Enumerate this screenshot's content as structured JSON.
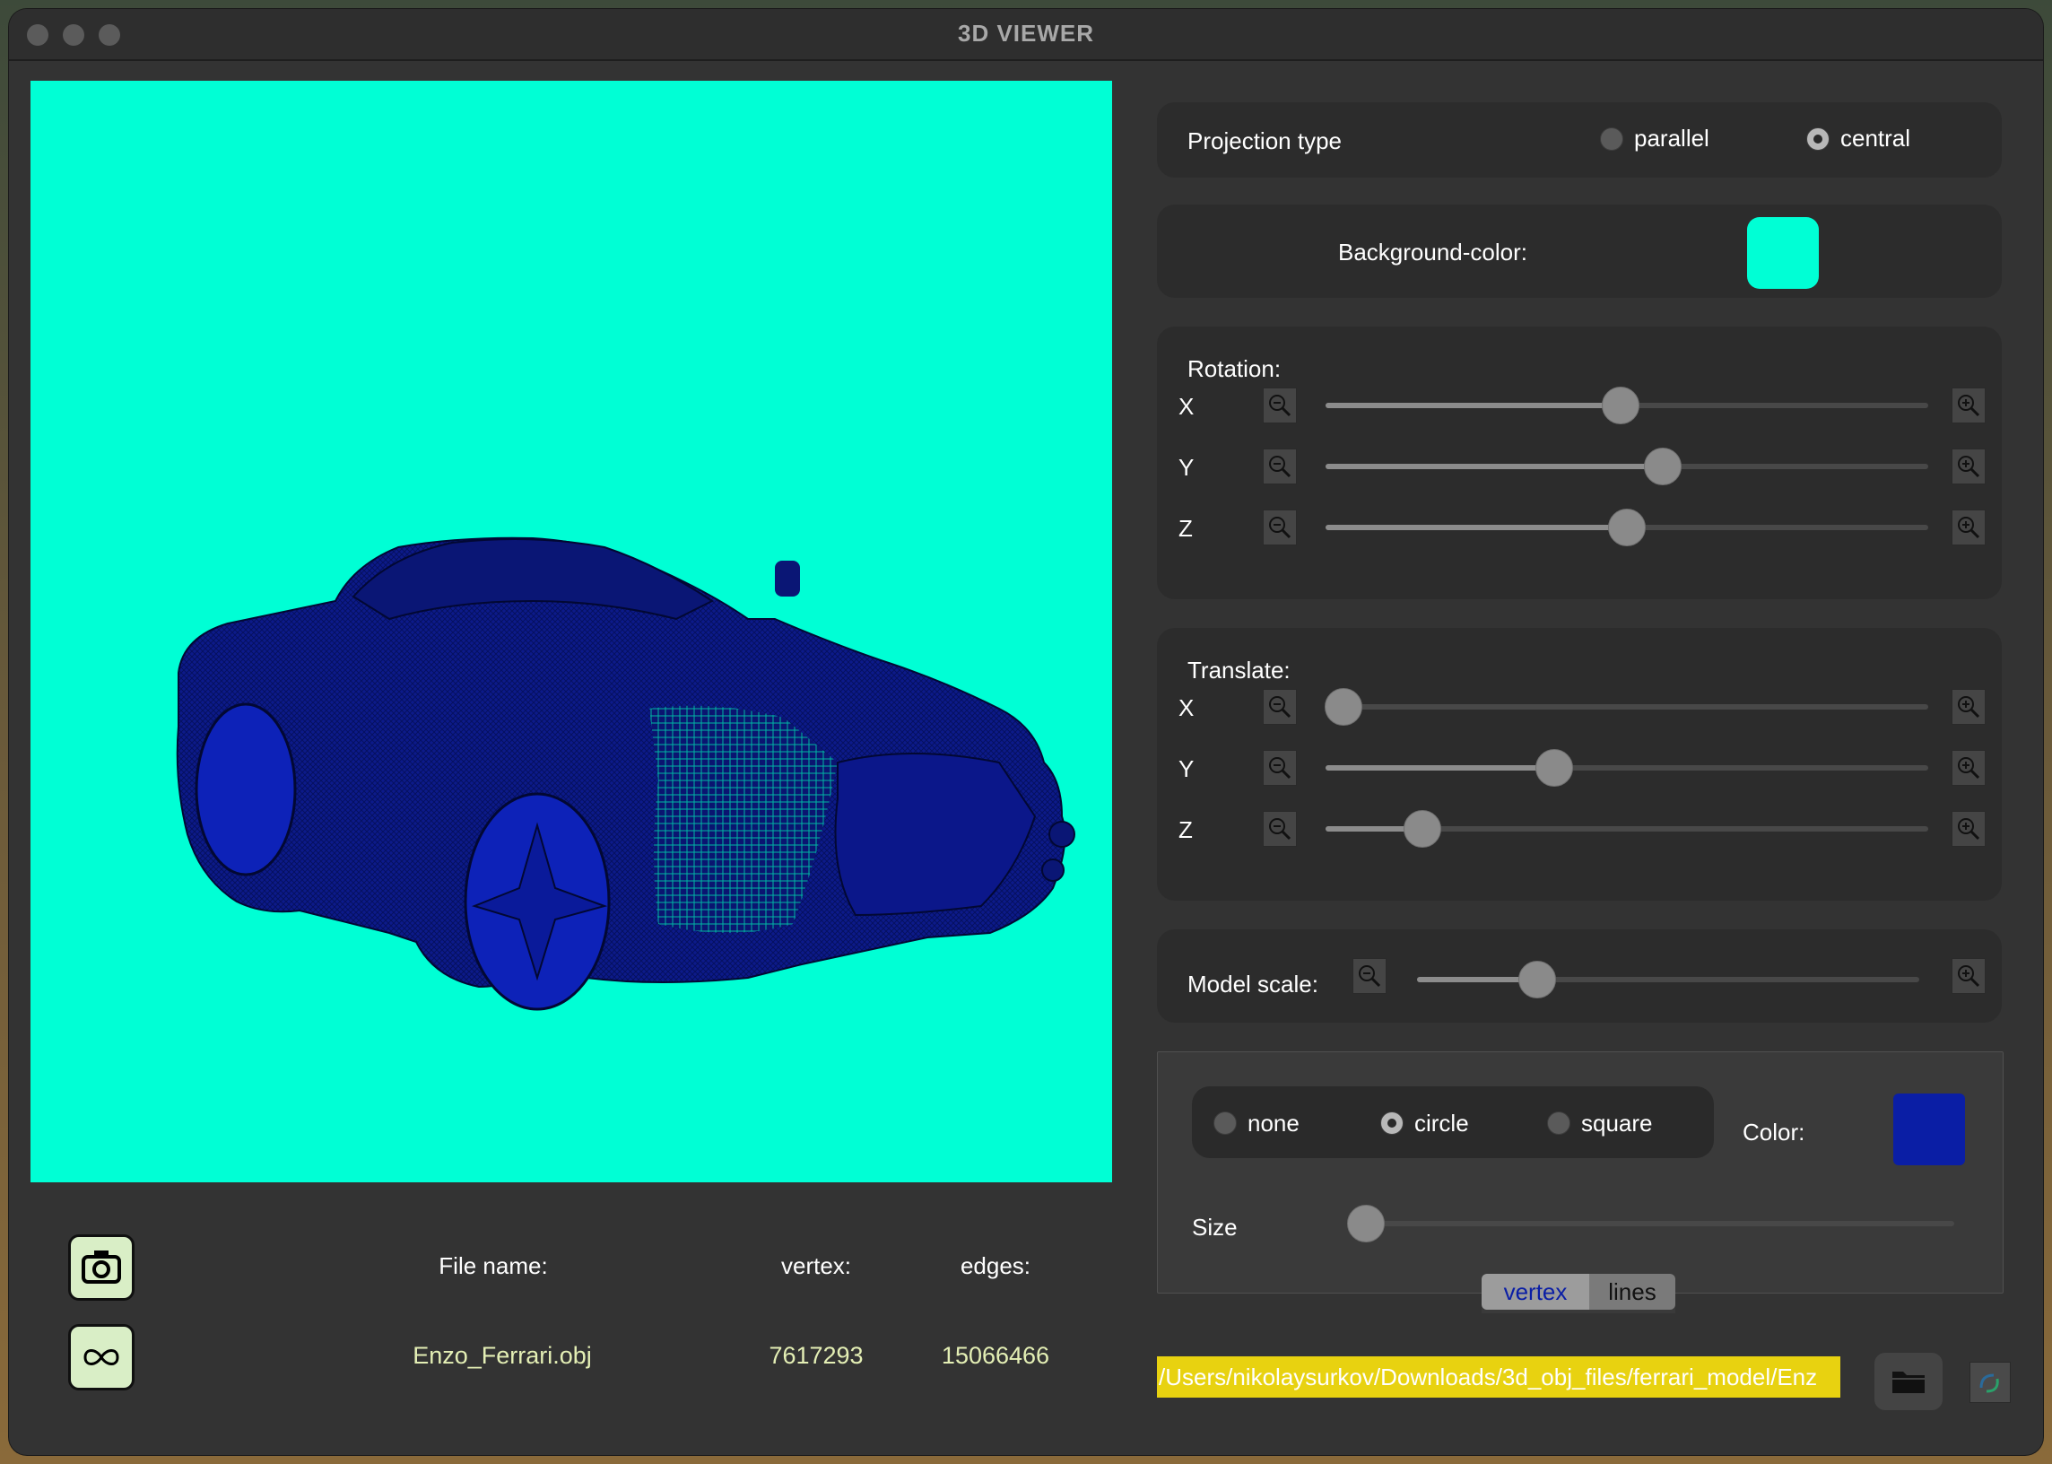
{
  "window": {
    "title": "3D VIEWER"
  },
  "projection": {
    "label": "Projection type",
    "options": [
      "parallel",
      "central"
    ],
    "selected": "central"
  },
  "background": {
    "label": "Background-color:",
    "color": "#00ffd5"
  },
  "rotation": {
    "label": "Rotation:",
    "axes": [
      {
        "name": "X",
        "value": 0.49
      },
      {
        "name": "Y",
        "value": 0.56
      },
      {
        "name": "Z",
        "value": 0.5
      }
    ]
  },
  "translate": {
    "label": "Translate:",
    "axes": [
      {
        "name": "X",
        "value": 0.03
      },
      {
        "name": "Y",
        "value": 0.38
      },
      {
        "name": "Z",
        "value": 0.16
      }
    ]
  },
  "scale": {
    "label": "Model scale:",
    "value": 0.24
  },
  "vertex_settings": {
    "options": [
      "none",
      "circle",
      "square"
    ],
    "selected": "circle",
    "color_label": "Color:",
    "color": "#0a1ea5",
    "size_label": "Size",
    "size_value": 0.03
  },
  "tabs": {
    "items": [
      "vertex",
      "lines"
    ],
    "active": "vertex"
  },
  "file": {
    "path": "/Users/nikolaysurkov/Downloads/3d_obj_files/ferrari_model/Enz",
    "name_label": "File name:",
    "vertex_label": "vertex:",
    "edges_label": "edges:",
    "name": "Enzo_Ferrari.obj",
    "vertex_count": "7617293",
    "edges_count": "15066466"
  },
  "icons": {
    "screenshot": "camera-icon",
    "gif": "infinity-icon",
    "open": "folder-icon",
    "render": "render-icon"
  }
}
